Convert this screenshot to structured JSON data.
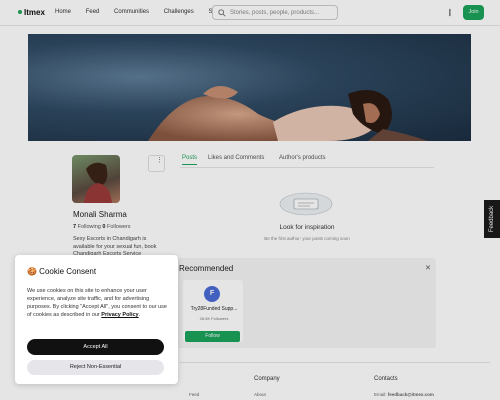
{
  "header": {
    "logo": "Itmex",
    "nav": [
      "Home",
      "Feed",
      "Communities",
      "Challenges",
      "Shop"
    ],
    "search_placeholder": "Stories, posts, people, products...",
    "join_label": "Join"
  },
  "profile": {
    "name": "Monali Sharma",
    "following_count": "7",
    "following_label": "Following",
    "followers_count": "0",
    "followers_label": "Followers",
    "bio": "Sexy Escorts in Chandigarh is available for your sexual fun, book Chandigarh Escorts Service"
  },
  "tabs": [
    "Posts",
    "Likes and Comments",
    "Author's products"
  ],
  "empty_state": {
    "title": "Look for inspiration",
    "subtitle": "Be the first author: your posts coming soon"
  },
  "recommended": {
    "title": "Recommended",
    "card": {
      "initial": "F",
      "name": "Try28Funded Supp...",
      "followers": "28.6K Followers",
      "follow_label": "Follow"
    }
  },
  "footer": {
    "company": "Company",
    "contacts": "Contacts",
    "col1_item": "Feed",
    "company_item": "About",
    "email_label": "Email:",
    "email": "feedback@itmex.com"
  },
  "feedback_tab": "Feedback",
  "cookie": {
    "title": "🍪 Cookie Consent",
    "body": "We use cookies on this site to enhance your user experience, analyze site traffic, and for advertising purposes. By clicking \"Accept All\", you consent to our use of cookies as described in our",
    "link": "Privacy Policy",
    "accept": "Accept All",
    "reject": "Reject Non-Essential"
  },
  "colors": {
    "accent": "#1aa35a",
    "dark": "#111111"
  }
}
